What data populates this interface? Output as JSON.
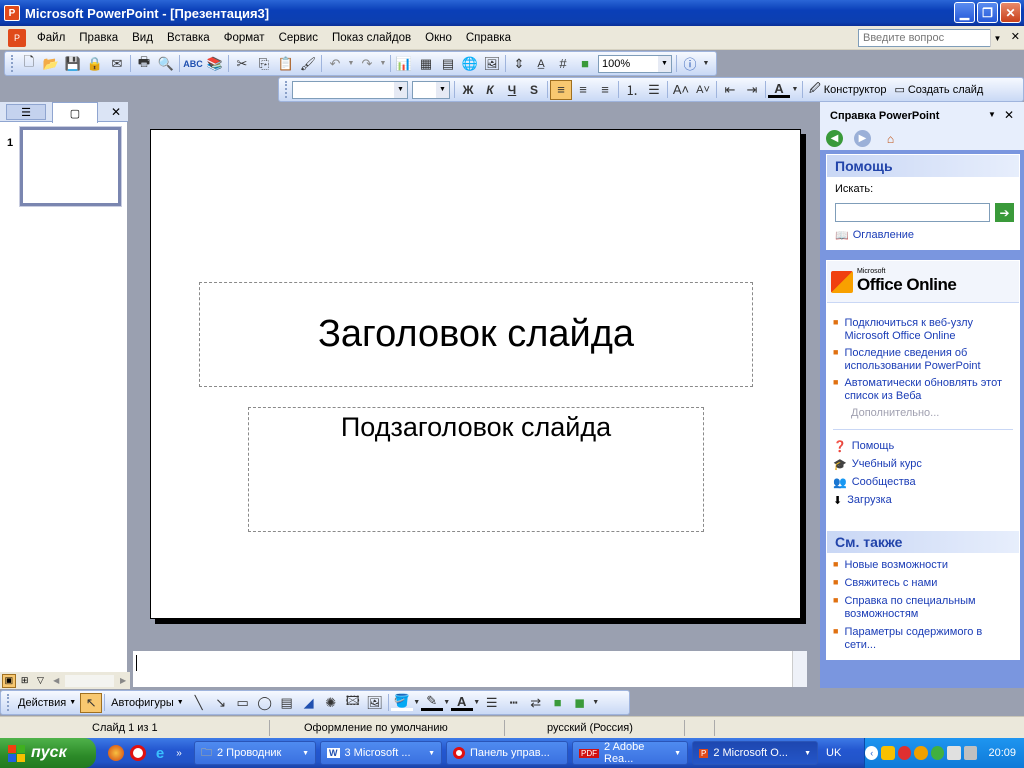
{
  "window": {
    "title": "Microsoft PowerPoint - [Презентация3]"
  },
  "menu": {
    "items": [
      "Файл",
      "Правка",
      "Вид",
      "Вставка",
      "Формат",
      "Сервис",
      "Показ слайдов",
      "Окно",
      "Справка"
    ],
    "help_placeholder": "Введите вопрос"
  },
  "toolbar": {
    "zoom": "100%"
  },
  "format_toolbar": {
    "font_name": "",
    "font_size": "",
    "bold": "Ж",
    "italic": "К",
    "underline": "Ч",
    "shadow": "S",
    "designer_label": "Конструктор",
    "new_slide_label": "Создать слайд"
  },
  "outline": {
    "slide_number": "1"
  },
  "slide": {
    "title": "Заголовок слайда",
    "subtitle": "Подзаголовок слайда"
  },
  "taskpane": {
    "title": "Справка PowerPoint",
    "help_header": "Помощь",
    "search_label": "Искать:",
    "toc_link": "Оглавление",
    "office_online_small": "Microsoft",
    "office_online": "Office Online",
    "online_links": [
      "Подключиться к веб-узлу Microsoft Office Online",
      "Последние сведения об использовании PowerPoint",
      "Автоматически обновлять этот список из Веба"
    ],
    "more": "Дополнительно...",
    "resources": [
      "Помощь",
      "Учебный курс",
      "Сообщества",
      "Загрузка"
    ],
    "see_also_header": "См. также",
    "see_also": [
      "Новые возможности",
      "Свяжитесь с нами",
      "Справка по специальным возможностям",
      "Параметры содержимого в сети..."
    ]
  },
  "draw_toolbar": {
    "actions": "Действия",
    "autoshapes": "Автофигуры"
  },
  "status": {
    "slide": "Слайд 1 из 1",
    "design": "Оформление по умолчанию",
    "language": "русский (Россия)"
  },
  "taskbar": {
    "start": "пуск",
    "tasks": [
      "2 Проводник",
      "3 Microsoft ...",
      "Панель управ...",
      "2 Adobe Rea...",
      "2 Microsoft O..."
    ],
    "lang": "UK",
    "clock": "20:09"
  },
  "colors": {
    "accent": "#0a3fb8",
    "taskpane": "#7a96df",
    "link": "#1a3cb6"
  }
}
